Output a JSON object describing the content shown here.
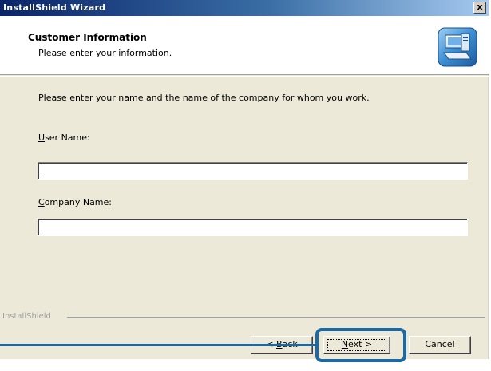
{
  "window": {
    "title": "InstallShield Wizard",
    "close_glyph": "x"
  },
  "header": {
    "title": "Customer Information",
    "subtitle": "Please enter your information.",
    "icon": "installer-computer-icon"
  },
  "body": {
    "instructions": "Please enter your name and the name of the company for whom you work.",
    "user_name": {
      "label_accel": "U",
      "label_rest": "ser Name:",
      "value": ""
    },
    "company_name": {
      "label_accel": "C",
      "label_rest": "ompany Name:",
      "value": ""
    }
  },
  "footer": {
    "brand": "InstallShield"
  },
  "buttons": {
    "back": {
      "prefix": "< ",
      "accel": "B",
      "rest": "ack"
    },
    "next": {
      "accel": "N",
      "rest": "ext",
      "suffix": " >"
    },
    "cancel": "Cancel"
  },
  "colors": {
    "callout": "#1b6aa5",
    "titlebar_start": "#0a246a",
    "dialog_bg": "#ece9d8"
  }
}
